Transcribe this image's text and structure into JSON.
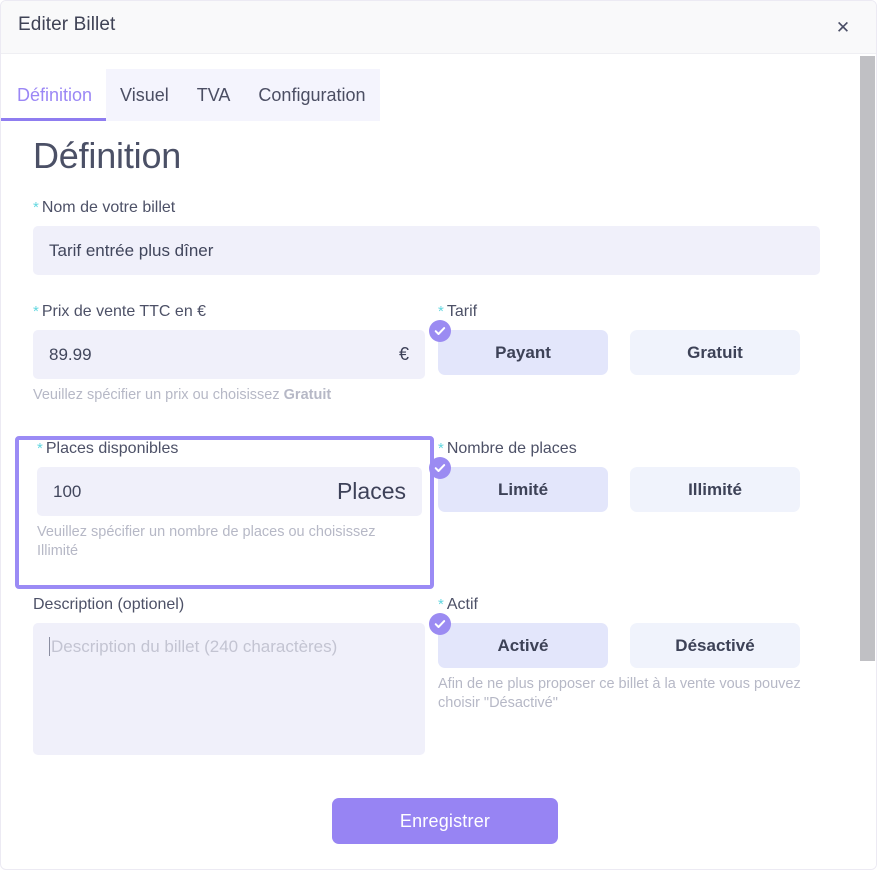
{
  "window": {
    "title": "Editer Billet",
    "close_icon": "close-icon",
    "close_glyph": "✕"
  },
  "tabs": [
    {
      "label": "Définition",
      "active": true
    },
    {
      "label": "Visuel",
      "active": false
    },
    {
      "label": "TVA",
      "active": false
    },
    {
      "label": "Configuration",
      "active": false
    }
  ],
  "page": {
    "heading": "Définition"
  },
  "fields": {
    "ticket_name": {
      "label": "Nom de votre billet",
      "required_marker": "*",
      "value": "Tarif entrée plus dîner"
    },
    "price": {
      "label": "Prix de vente TTC en €",
      "required_marker": "*",
      "value": "89.99",
      "suffix": "€",
      "helper": "Veuillez spécifier un prix ou choisissez ",
      "helper_strong": "Gratuit"
    },
    "places": {
      "label": "Places disponibles",
      "required_marker": "*",
      "value": "100",
      "suffix": "Places",
      "helper": "Veuillez spécifier un nombre de places ou choisissez Illimité"
    },
    "description": {
      "label": "Description (optionel)",
      "value": "",
      "placeholder": "Description du billet (240 charactères)"
    }
  },
  "toggles": {
    "tarif": {
      "label": "Tarif",
      "required_marker": "*",
      "options": [
        {
          "label": "Payant",
          "selected": true
        },
        {
          "label": "Gratuit",
          "selected": false
        }
      ]
    },
    "nombre_places": {
      "label": "Nombre de places",
      "required_marker": "*",
      "options": [
        {
          "label": "Limité",
          "selected": true
        },
        {
          "label": "Illimité",
          "selected": false
        }
      ]
    },
    "actif": {
      "label": "Actif",
      "required_marker": "*",
      "options": [
        {
          "label": "Activé",
          "selected": true
        },
        {
          "label": "Désactivé",
          "selected": false
        }
      ],
      "helper": "Afin de ne plus proposer ce billet à la vente vous pouvez choisir \"Désactivé\""
    }
  },
  "actions": {
    "save_label": "Enregistrer"
  },
  "colors": {
    "accent_purple": "#9784f3",
    "highlight_border": "#9b8bf5",
    "input_bg": "#f0f0fa",
    "required_teal": "#63d7e0",
    "toggle_selected_bg": "#e3e6fb",
    "toggle_bg": "#f0f3fc"
  }
}
